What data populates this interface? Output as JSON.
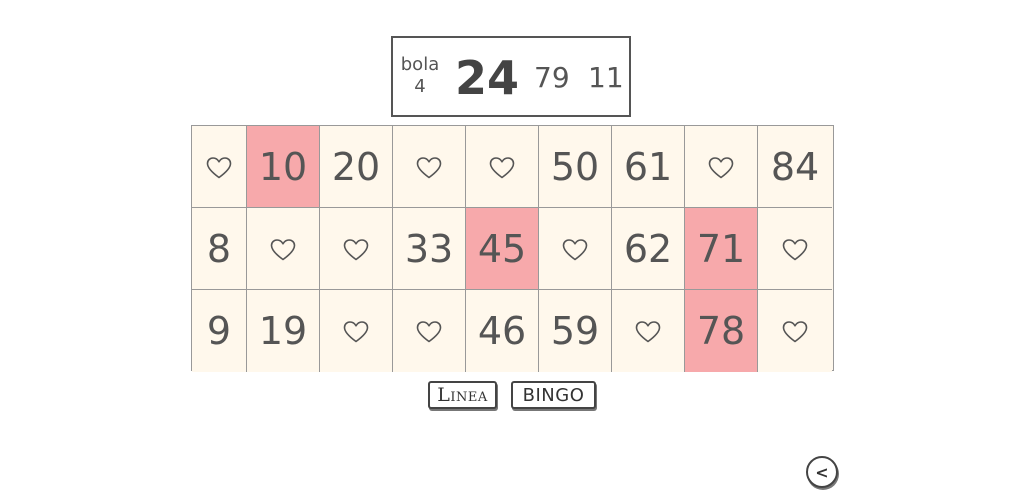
{
  "ball_display": {
    "label": "bola",
    "count": "4",
    "current": "24",
    "previous": [
      "79",
      "11"
    ]
  },
  "card": {
    "rows": [
      [
        {
          "value": null,
          "marked": false
        },
        {
          "value": "10",
          "marked": true
        },
        {
          "value": "20",
          "marked": false
        },
        {
          "value": null,
          "marked": false
        },
        {
          "value": null,
          "marked": false
        },
        {
          "value": "50",
          "marked": false
        },
        {
          "value": "61",
          "marked": false
        },
        {
          "value": null,
          "marked": false
        },
        {
          "value": "84",
          "marked": false
        }
      ],
      [
        {
          "value": "8",
          "marked": false
        },
        {
          "value": null,
          "marked": false
        },
        {
          "value": null,
          "marked": false
        },
        {
          "value": "33",
          "marked": false
        },
        {
          "value": "45",
          "marked": true
        },
        {
          "value": null,
          "marked": false
        },
        {
          "value": "62",
          "marked": false
        },
        {
          "value": "71",
          "marked": true
        },
        {
          "value": null,
          "marked": false
        }
      ],
      [
        {
          "value": "9",
          "marked": false
        },
        {
          "value": "19",
          "marked": false
        },
        {
          "value": null,
          "marked": false
        },
        {
          "value": null,
          "marked": false
        },
        {
          "value": "46",
          "marked": false
        },
        {
          "value": "59",
          "marked": false
        },
        {
          "value": null,
          "marked": false
        },
        {
          "value": "78",
          "marked": true
        },
        {
          "value": null,
          "marked": false
        }
      ]
    ],
    "empty_icon": "heart-icon",
    "colors": {
      "cell": "#fff8ec",
      "marked": "#f7a9ab",
      "text": "#555555"
    }
  },
  "buttons": {
    "linea": "Linea",
    "bingo": "BINGO",
    "back": "<"
  }
}
